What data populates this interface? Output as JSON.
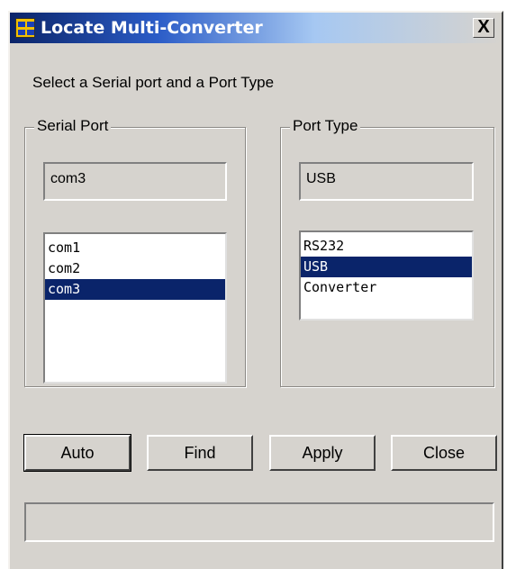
{
  "window": {
    "title": "Locate Multi-Converter",
    "close_label": "X",
    "icon": "app-icon"
  },
  "instruction": "Select a Serial port and a Port Type",
  "serial_port": {
    "legend": "Serial Port",
    "current_value": "com3",
    "items": [
      "com1",
      "com2",
      "com3"
    ],
    "selected": "com3"
  },
  "port_type": {
    "legend": "Port Type",
    "current_value": "USB",
    "items": [
      "RS232",
      "USB",
      "Converter"
    ],
    "selected": "USB"
  },
  "buttons": {
    "auto": "Auto",
    "find": "Find",
    "apply": "Apply",
    "close": "Close"
  },
  "status": "",
  "colors": {
    "selection": "#0a246a",
    "face": "#d6d3ce"
  }
}
